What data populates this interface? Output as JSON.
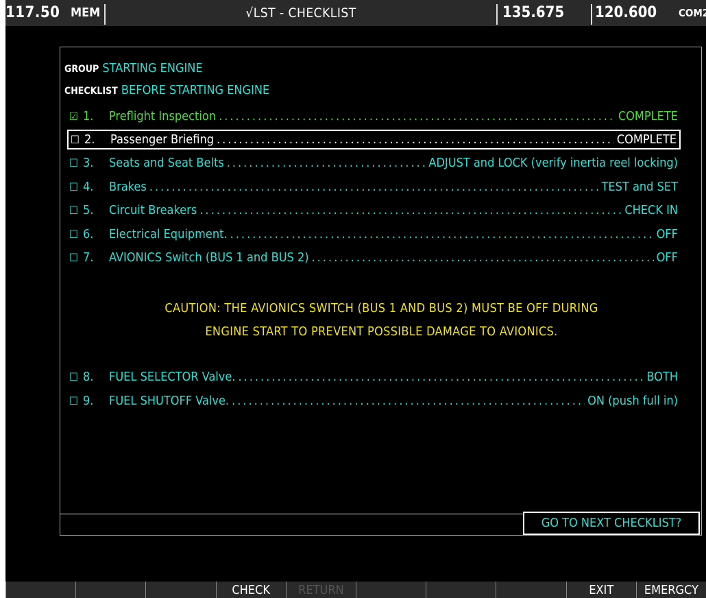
{
  "topbar": {
    "nav_freq": "117.50",
    "mem_label": "MEM",
    "title": "√LST - CHECKLIST",
    "com_active": "135.675",
    "com_standby": "120.600",
    "com_label": "COM2"
  },
  "checklist": {
    "group_label": "GROUP",
    "group_value": "STARTING ENGINE",
    "checklist_label": "CHECKLIST",
    "checklist_value": "BEFORE STARTING ENGINE",
    "items": [
      {
        "num": "1.",
        "text": "Preflight Inspection",
        "action": "COMPLETE",
        "checked": true
      },
      {
        "num": "2.",
        "text": "Passenger Briefing",
        "action": "COMPLETE",
        "checked": false
      },
      {
        "num": "3.",
        "text": "Seats and Seat Belts",
        "action": "ADJUST and LOCK  (verify inertia reel locking)",
        "checked": false
      },
      {
        "num": "4.",
        "text": "Brakes",
        "action": "TEST and SET",
        "checked": false
      },
      {
        "num": "5.",
        "text": "Circuit Breakers",
        "action": "CHECK IN",
        "checked": false
      },
      {
        "num": "6.",
        "text": "Electrical Equipment.",
        "action": "OFF",
        "checked": false
      },
      {
        "num": "7.",
        "text": "AVIONICS Switch (BUS 1 and BUS 2)",
        "action": "OFF",
        "checked": false
      },
      {
        "num": "8.",
        "text": "FUEL SELECTOR Valve.",
        "action": "BOTH",
        "checked": false
      },
      {
        "num": "9.",
        "text": "FUEL SHUTOFF Valve.",
        "action": "ON (push full in)",
        "checked": false
      }
    ],
    "caution_line1": "CAUTION:  THE AVIONICS SWITCH (BUS 1 AND BUS 2) MUST BE OFF DURING",
    "caution_line2": "ENGINE START TO PREVENT POSSIBLE DAMAGE TO AVIONICS.",
    "next_button": "GO TO NEXT CHECKLIST?"
  },
  "softkeys": [
    "",
    "",
    "",
    "CHECK",
    "RETURN",
    "",
    "",
    "",
    "EXIT",
    "EMERGCY"
  ],
  "colors": {
    "item_text": "#2ce0d6",
    "checked_text": "#4ddd3a",
    "caution": "#f2e21a",
    "background": "#000000"
  }
}
